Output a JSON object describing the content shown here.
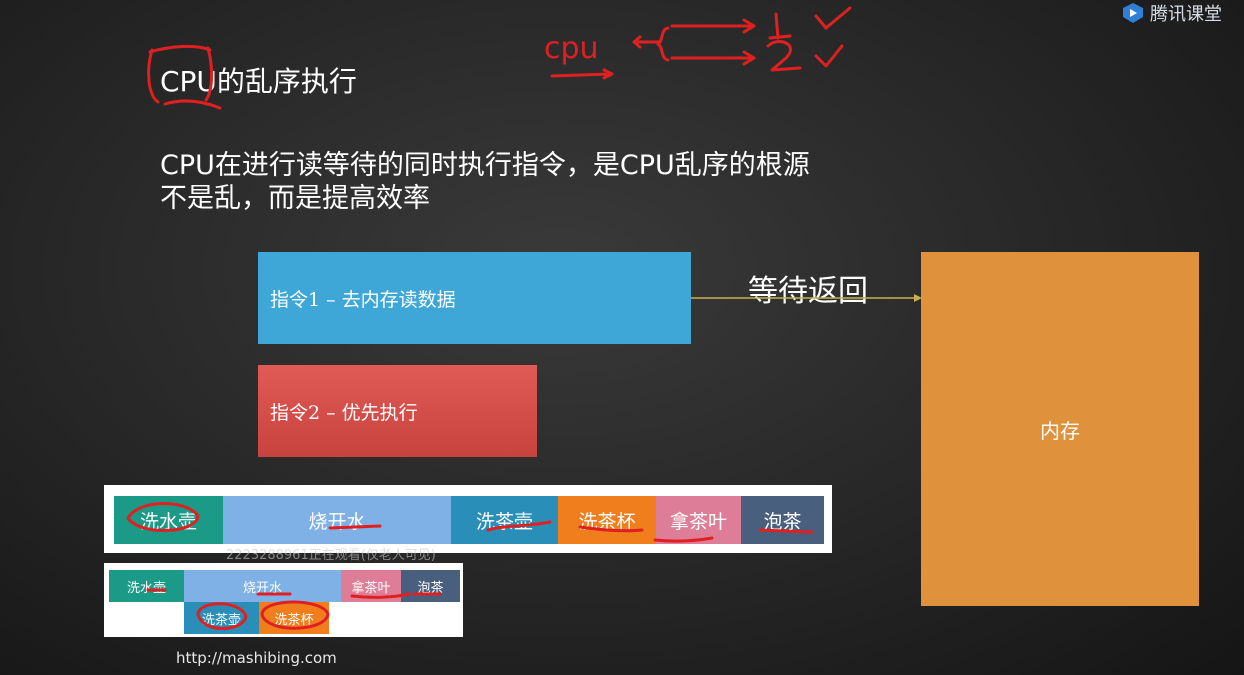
{
  "brand": {
    "name": "腾讯课堂",
    "icon": "play-shield-icon"
  },
  "slide": {
    "title": "CPU的乱序执行",
    "subtitle_line1": "CPU在进行读等待的同时执行指令，是CPU乱序的根源",
    "subtitle_line2": "不是乱，而是提高效率"
  },
  "diagram": {
    "instruction1": "指令1 – 去内存读数据",
    "instruction2": "指令2 – 优先执行",
    "wait_label": "等待返回",
    "memory_label": "内存"
  },
  "sequential_steps": [
    {
      "label": "洗水壶",
      "color": "#1a9a87"
    },
    {
      "label": "烧开水",
      "color": "#7fb0e6"
    },
    {
      "label": "洗茶壶",
      "color": "#2a8fb8"
    },
    {
      "label": "洗茶杯",
      "color": "#f07e1d"
    },
    {
      "label": "拿茶叶",
      "color": "#de7d97"
    },
    {
      "label": "泡茶",
      "color": "#48607e"
    }
  ],
  "parallel_steps": {
    "row1": [
      {
        "label": "洗水壶",
        "color": "#1a9a87"
      },
      {
        "label": "烧开水",
        "color": "#7fb0e6"
      },
      {
        "label": "拿茶叶",
        "color": "#de7d97"
      },
      {
        "label": "泡茶",
        "color": "#48607e"
      }
    ],
    "row2": [
      {
        "label": "洗茶壶",
        "color": "#2a8fb8"
      },
      {
        "label": "洗茶杯",
        "color": "#f07e1d"
      }
    ]
  },
  "watermark": "2223288961正在观看(仅老人可见)",
  "footer_url": "http://mashibing.com",
  "annotations": {
    "handwriting_cpu": "cpu",
    "handwriting_1": "1",
    "handwriting_2": "2"
  }
}
